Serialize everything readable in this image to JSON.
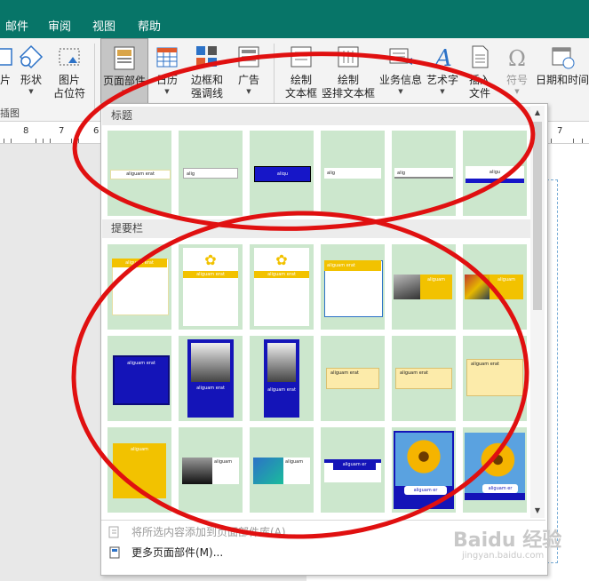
{
  "menu": {
    "tabs": [
      "邮件",
      "审阅",
      "视图",
      "帮助"
    ]
  },
  "ribbon": {
    "buttons": [
      {
        "label": "片",
        "label2": ""
      },
      {
        "label": "形状",
        "label2": ""
      },
      {
        "label": "图片",
        "label2": "占位符"
      },
      {
        "label": "页面部件",
        "label2": ""
      },
      {
        "label": "日历",
        "label2": ""
      },
      {
        "label": "边框和",
        "label2": "强调线"
      },
      {
        "label": "广告",
        "label2": ""
      },
      {
        "label": "绘制",
        "label2": "文本框"
      },
      {
        "label": "绘制",
        "label2": "竖排文本框"
      },
      {
        "label": "业务信息",
        "label2": ""
      },
      {
        "label": "艺术字",
        "label2": ""
      },
      {
        "label": "插入",
        "label2": "文件"
      },
      {
        "label": "符号",
        "label2": ""
      },
      {
        "label": "日期和时间",
        "label2": ""
      }
    ],
    "group_label": "插图"
  },
  "ruler": {
    "numbers": [
      "8",
      "7",
      "6",
      "7"
    ]
  },
  "gallery": {
    "section_title": "标题",
    "section_sidebar": "提要栏",
    "title_items": [
      "aliguam erat",
      "alig",
      "aliqu",
      "alig",
      "alig",
      "aligu"
    ],
    "sidebar_items": [
      "aliguam erat",
      "aliguam erat",
      "aliguam erat",
      "aliguam erat",
      "aliguam",
      "aliguam",
      "aliguam erat",
      "aliguam erat",
      "aliguam erat",
      "aliguam erat",
      "aliguam erat",
      "aliguam erat",
      "aliguam",
      "aliguam",
      "aliguam",
      "aliguam er",
      "aliguam er",
      "aliguam er"
    ],
    "footer": {
      "save_label": "将所选内容添加到页面部件库(A)...",
      "more_label": "更多页面部件(M)..."
    }
  },
  "watermark": {
    "text": "Baidu 经验",
    "sub": "jingyan.baidu.com"
  },
  "colors": {
    "accent_green": "#077568",
    "thumb_bg": "#cce7cd",
    "annotation_red": "#e01010"
  }
}
